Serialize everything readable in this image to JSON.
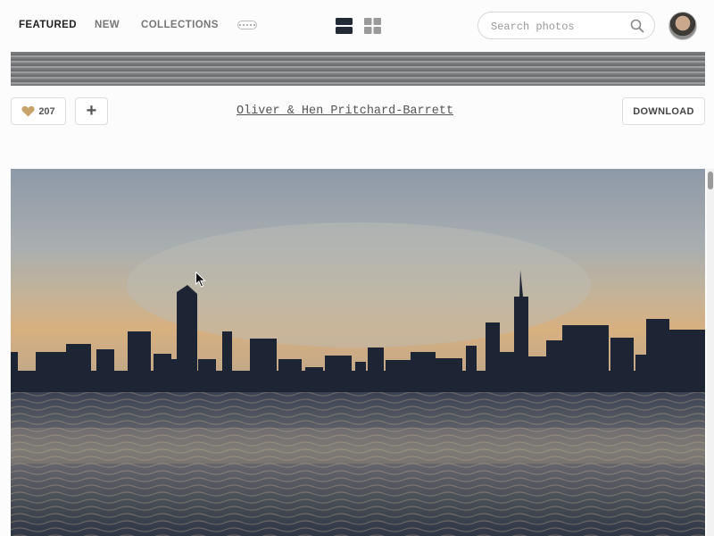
{
  "nav": {
    "featured": "FEATURED",
    "new": "NEW",
    "collections": "COLLECTIONS",
    "more_icon": "more-dots-icon",
    "layout_single_icon": "single-column-layout-icon",
    "layout_grid_icon": "grid-layout-icon"
  },
  "search": {
    "placeholder": "Search photos",
    "icon": "search-icon"
  },
  "photo": {
    "likes": "207",
    "like_icon": "heart-icon",
    "add_label": "+",
    "author": "Oliver & Hen Pritchard-Barrett",
    "download_label": "DOWNLOAD"
  },
  "colors": {
    "heart": "#c8a46a",
    "layout_active": "#222a35",
    "layout_inactive": "#9a9a9a"
  }
}
